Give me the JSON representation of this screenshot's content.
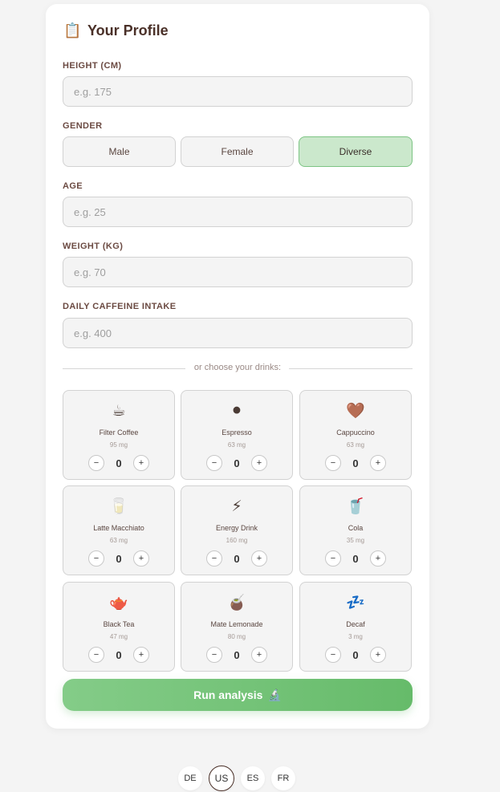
{
  "profile": {
    "title": "Your Profile",
    "title_icon": "clipboard-icon"
  },
  "fields": {
    "height": {
      "label": "HEIGHT (CM)",
      "placeholder": "e.g. 175",
      "value": ""
    },
    "gender": {
      "label": "GENDER",
      "options": [
        "Male",
        "Female",
        "Diverse"
      ],
      "selected": "Diverse"
    },
    "age": {
      "label": "AGE",
      "placeholder": "e.g. 25",
      "value": ""
    },
    "weight": {
      "label": "WEIGHT (KG)",
      "placeholder": "e.g. 70",
      "value": ""
    },
    "caffeine": {
      "label": "DAILY CAFFEINE INTAKE",
      "placeholder": "e.g. 400",
      "value": ""
    }
  },
  "divider_text": "or choose your drinks:",
  "drinks": [
    {
      "emoji": "☕",
      "name": "Filter Coffee",
      "mg": "95 mg",
      "count": "0"
    },
    {
      "emoji": "⚫",
      "name": "Espresso",
      "mg": "63 mg",
      "count": "0"
    },
    {
      "emoji": "🤎",
      "name": "Cappuccino",
      "mg": "63 mg",
      "count": "0"
    },
    {
      "emoji": "🥛",
      "name": "Latte Macchiato",
      "mg": "63 mg",
      "count": "0"
    },
    {
      "emoji": "⚡",
      "name": "Energy Drink",
      "mg": "160 mg",
      "count": "0"
    },
    {
      "emoji": "🥤",
      "name": "Cola",
      "mg": "35 mg",
      "count": "0"
    },
    {
      "emoji": "🫖",
      "name": "Black Tea",
      "mg": "47 mg",
      "count": "0"
    },
    {
      "emoji": "🧉",
      "name": "Mate Lemonade",
      "mg": "80 mg",
      "count": "0"
    },
    {
      "emoji": "💤",
      "name": "Decaf",
      "mg": "3 mg",
      "count": "0"
    }
  ],
  "stepper": {
    "minus": "−",
    "plus": "+"
  },
  "run_button": {
    "label": "Run analysis",
    "icon": "🔬"
  },
  "languages": [
    {
      "code": "DE",
      "active": false
    },
    {
      "code": "US",
      "active": true
    },
    {
      "code": "ES",
      "active": false
    },
    {
      "code": "FR",
      "active": false
    }
  ],
  "colors": {
    "accent_green": "#66bb6a",
    "selected_bg": "#cbe8cc",
    "title_brown": "#4a3028"
  }
}
